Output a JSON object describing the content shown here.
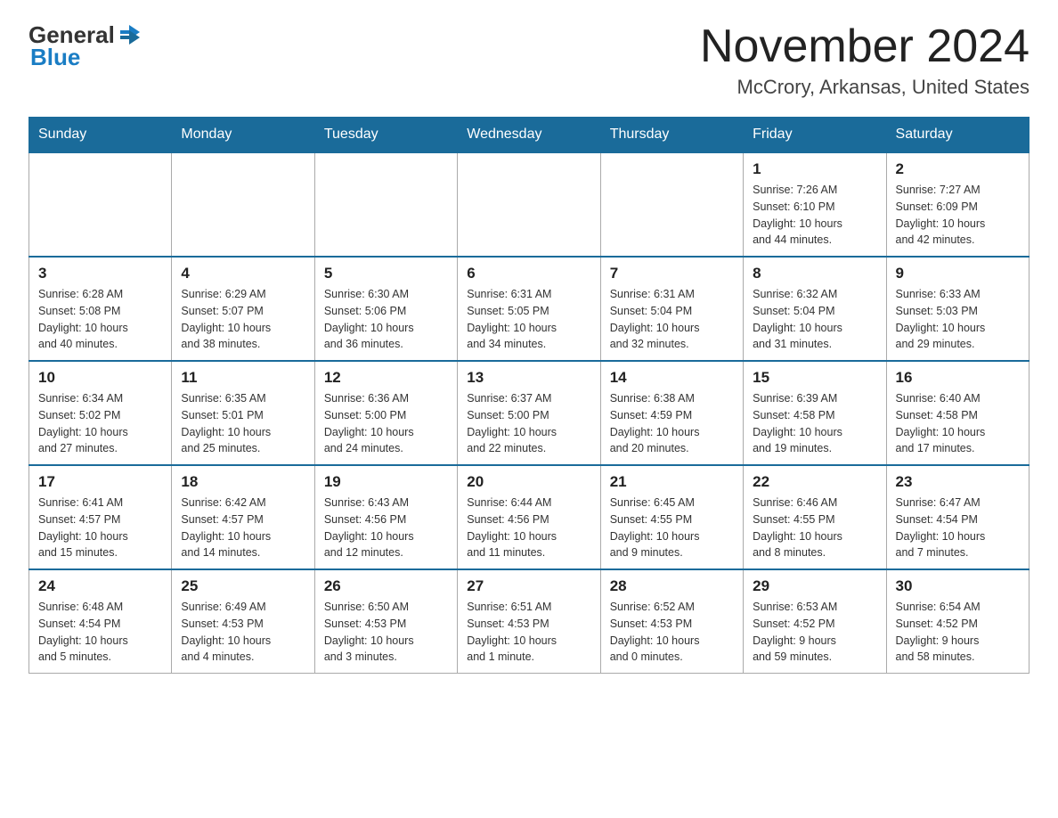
{
  "header": {
    "logo_general": "General",
    "logo_blue": "Blue",
    "title": "November 2024",
    "subtitle": "McCrory, Arkansas, United States"
  },
  "weekdays": [
    "Sunday",
    "Monday",
    "Tuesday",
    "Wednesday",
    "Thursday",
    "Friday",
    "Saturday"
  ],
  "weeks": [
    [
      {
        "day": "",
        "info": ""
      },
      {
        "day": "",
        "info": ""
      },
      {
        "day": "",
        "info": ""
      },
      {
        "day": "",
        "info": ""
      },
      {
        "day": "",
        "info": ""
      },
      {
        "day": "1",
        "info": "Sunrise: 7:26 AM\nSunset: 6:10 PM\nDaylight: 10 hours\nand 44 minutes."
      },
      {
        "day": "2",
        "info": "Sunrise: 7:27 AM\nSunset: 6:09 PM\nDaylight: 10 hours\nand 42 minutes."
      }
    ],
    [
      {
        "day": "3",
        "info": "Sunrise: 6:28 AM\nSunset: 5:08 PM\nDaylight: 10 hours\nand 40 minutes."
      },
      {
        "day": "4",
        "info": "Sunrise: 6:29 AM\nSunset: 5:07 PM\nDaylight: 10 hours\nand 38 minutes."
      },
      {
        "day": "5",
        "info": "Sunrise: 6:30 AM\nSunset: 5:06 PM\nDaylight: 10 hours\nand 36 minutes."
      },
      {
        "day": "6",
        "info": "Sunrise: 6:31 AM\nSunset: 5:05 PM\nDaylight: 10 hours\nand 34 minutes."
      },
      {
        "day": "7",
        "info": "Sunrise: 6:31 AM\nSunset: 5:04 PM\nDaylight: 10 hours\nand 32 minutes."
      },
      {
        "day": "8",
        "info": "Sunrise: 6:32 AM\nSunset: 5:04 PM\nDaylight: 10 hours\nand 31 minutes."
      },
      {
        "day": "9",
        "info": "Sunrise: 6:33 AM\nSunset: 5:03 PM\nDaylight: 10 hours\nand 29 minutes."
      }
    ],
    [
      {
        "day": "10",
        "info": "Sunrise: 6:34 AM\nSunset: 5:02 PM\nDaylight: 10 hours\nand 27 minutes."
      },
      {
        "day": "11",
        "info": "Sunrise: 6:35 AM\nSunset: 5:01 PM\nDaylight: 10 hours\nand 25 minutes."
      },
      {
        "day": "12",
        "info": "Sunrise: 6:36 AM\nSunset: 5:00 PM\nDaylight: 10 hours\nand 24 minutes."
      },
      {
        "day": "13",
        "info": "Sunrise: 6:37 AM\nSunset: 5:00 PM\nDaylight: 10 hours\nand 22 minutes."
      },
      {
        "day": "14",
        "info": "Sunrise: 6:38 AM\nSunset: 4:59 PM\nDaylight: 10 hours\nand 20 minutes."
      },
      {
        "day": "15",
        "info": "Sunrise: 6:39 AM\nSunset: 4:58 PM\nDaylight: 10 hours\nand 19 minutes."
      },
      {
        "day": "16",
        "info": "Sunrise: 6:40 AM\nSunset: 4:58 PM\nDaylight: 10 hours\nand 17 minutes."
      }
    ],
    [
      {
        "day": "17",
        "info": "Sunrise: 6:41 AM\nSunset: 4:57 PM\nDaylight: 10 hours\nand 15 minutes."
      },
      {
        "day": "18",
        "info": "Sunrise: 6:42 AM\nSunset: 4:57 PM\nDaylight: 10 hours\nand 14 minutes."
      },
      {
        "day": "19",
        "info": "Sunrise: 6:43 AM\nSunset: 4:56 PM\nDaylight: 10 hours\nand 12 minutes."
      },
      {
        "day": "20",
        "info": "Sunrise: 6:44 AM\nSunset: 4:56 PM\nDaylight: 10 hours\nand 11 minutes."
      },
      {
        "day": "21",
        "info": "Sunrise: 6:45 AM\nSunset: 4:55 PM\nDaylight: 10 hours\nand 9 minutes."
      },
      {
        "day": "22",
        "info": "Sunrise: 6:46 AM\nSunset: 4:55 PM\nDaylight: 10 hours\nand 8 minutes."
      },
      {
        "day": "23",
        "info": "Sunrise: 6:47 AM\nSunset: 4:54 PM\nDaylight: 10 hours\nand 7 minutes."
      }
    ],
    [
      {
        "day": "24",
        "info": "Sunrise: 6:48 AM\nSunset: 4:54 PM\nDaylight: 10 hours\nand 5 minutes."
      },
      {
        "day": "25",
        "info": "Sunrise: 6:49 AM\nSunset: 4:53 PM\nDaylight: 10 hours\nand 4 minutes."
      },
      {
        "day": "26",
        "info": "Sunrise: 6:50 AM\nSunset: 4:53 PM\nDaylight: 10 hours\nand 3 minutes."
      },
      {
        "day": "27",
        "info": "Sunrise: 6:51 AM\nSunset: 4:53 PM\nDaylight: 10 hours\nand 1 minute."
      },
      {
        "day": "28",
        "info": "Sunrise: 6:52 AM\nSunset: 4:53 PM\nDaylight: 10 hours\nand 0 minutes."
      },
      {
        "day": "29",
        "info": "Sunrise: 6:53 AM\nSunset: 4:52 PM\nDaylight: 9 hours\nand 59 minutes."
      },
      {
        "day": "30",
        "info": "Sunrise: 6:54 AM\nSunset: 4:52 PM\nDaylight: 9 hours\nand 58 minutes."
      }
    ]
  ]
}
